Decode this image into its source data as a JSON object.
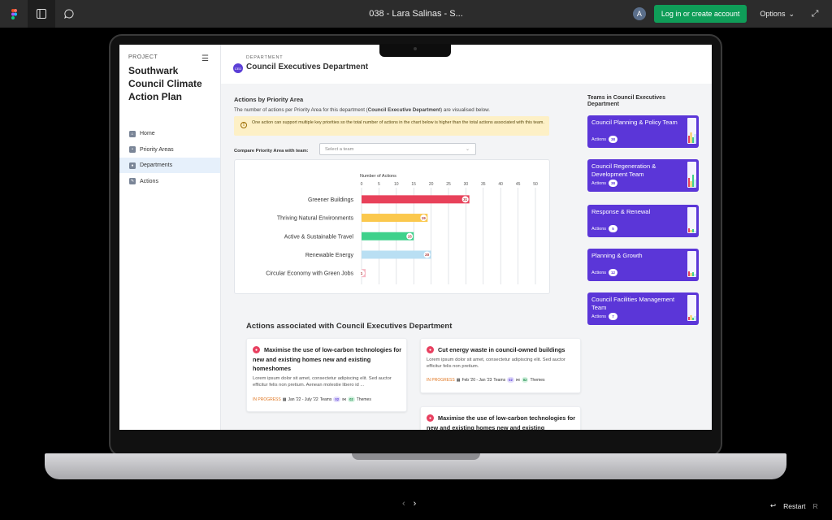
{
  "topbar": {
    "title": "038 - Lara Salinas - S...",
    "avatar": "A",
    "login_label": "Log in or create account",
    "options_label": "Options"
  },
  "sidebar": {
    "project_label": "PROJECT",
    "project_title": "Southwark Council Climate Action Plan",
    "items": [
      {
        "label": "Home",
        "icon": "home-icon"
      },
      {
        "label": "Priority Areas",
        "icon": "pin-icon"
      },
      {
        "label": "Departments",
        "icon": "users-icon"
      },
      {
        "label": "Actions",
        "icon": "pencil-icon"
      }
    ]
  },
  "header": {
    "badge": "CED",
    "label": "DEPARTMENT",
    "title": "Council Executives Department"
  },
  "priority": {
    "title": "Actions by Priority Area",
    "desc_prefix": "The number of actions per Priority Area for this department (",
    "desc_bold": "Council Executive Department",
    "desc_suffix": ") are visualised below.",
    "warning": "One action can support multiple key priorities so the total number of actions in the chart below is higher than the total actions associated with this team.",
    "compare_label": "Compare Priority Area with team:",
    "select_placeholder": "Select a team"
  },
  "chart_data": {
    "type": "bar",
    "orientation": "horizontal",
    "title": "Number of Actions",
    "categories": [
      "Greener Buildings",
      "Thriving Natural Environments",
      "Active & Sustainable Travel",
      "Renewable Energy",
      "Circular Economy with Green Jobs"
    ],
    "values": [
      31,
      19,
      15,
      20,
      1
    ],
    "colors": [
      "#e8415a",
      "#fbc84d",
      "#3fd18c",
      "#b9dff3",
      "#f6b8c4"
    ],
    "xlim": [
      0,
      50
    ],
    "ticks": [
      0,
      5,
      10,
      15,
      20,
      25,
      30,
      35,
      40,
      45,
      50
    ],
    "grid": true
  },
  "actions": {
    "title": "Actions associated with Council Executives Department",
    "items": [
      {
        "title": "Maximise the use of low-carbon technologies for new and existing homes new and existing homeshomes",
        "desc": "Lorem ipsum dolor sit amet, consectetur adipiscing elit. Sed auctor efficitur felis non pretium. Aenean molestie libero id ...",
        "status": "IN PROGRESS",
        "dates": "Jan '22 - July '22",
        "teams_label": "Teams",
        "teams_count": "02",
        "themes_count": "02",
        "themes_label": "Themes"
      },
      {
        "title": "Cut energy waste in council-owned buildings",
        "desc": "Lorem ipsum dolor sit amet, consectetur adipiscing elit. Sed auctor efficitur felis non pretium.",
        "status": "IN PROGRESS",
        "dates": "Feb '20 - Jan '23",
        "teams_label": "Teams",
        "teams_count": "02",
        "themes_count": "02",
        "themes_label": "Themes"
      },
      {
        "title": "Maximise the use of low-carbon technologies for new and existing homes new and existing"
      }
    ]
  },
  "teams": {
    "title": "Teams in Council Executives Department",
    "actions_label": "Actions",
    "items": [
      {
        "name": "Council Planning & Policy Team",
        "count": "38"
      },
      {
        "name": "Council Regeneration & Development Team",
        "count": "38"
      },
      {
        "name": "Response & Renewal",
        "count": "5"
      },
      {
        "name": "Planning & Growth",
        "count": "12"
      },
      {
        "name": "Council Facilities Management Team",
        "count": "7"
      }
    ]
  },
  "footer": {
    "restart_label": "Restart",
    "restart_key": "R"
  }
}
